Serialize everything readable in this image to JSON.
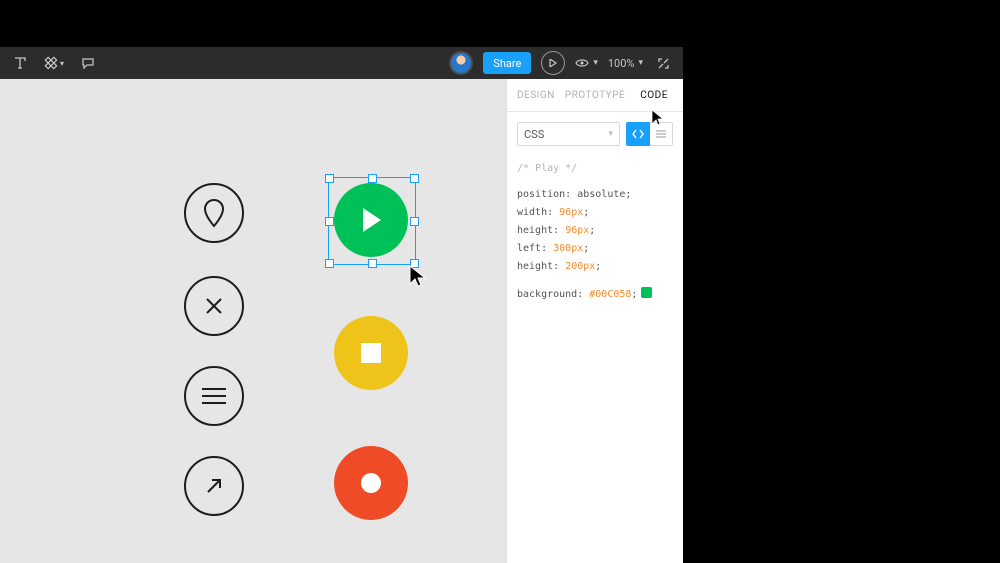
{
  "toolbar": {
    "share_label": "Share",
    "zoom_label": "100%"
  },
  "panel": {
    "tabs": {
      "design": "DESIGN",
      "prototype": "PROTOTYPE",
      "code": "CODE"
    },
    "lang_selected": "CSS",
    "comment": "/* Play */",
    "lines": {
      "pos_k": "position:",
      "pos_v": "absolute",
      "w_k": "width:",
      "w_v": "96px",
      "h_k": "height:",
      "h_v": "96px",
      "l_k": "left:",
      "l_v": "300px",
      "t_k": "height:",
      "t_v": "200px",
      "bg_k": "background:",
      "bg_v": "#00C058"
    }
  }
}
